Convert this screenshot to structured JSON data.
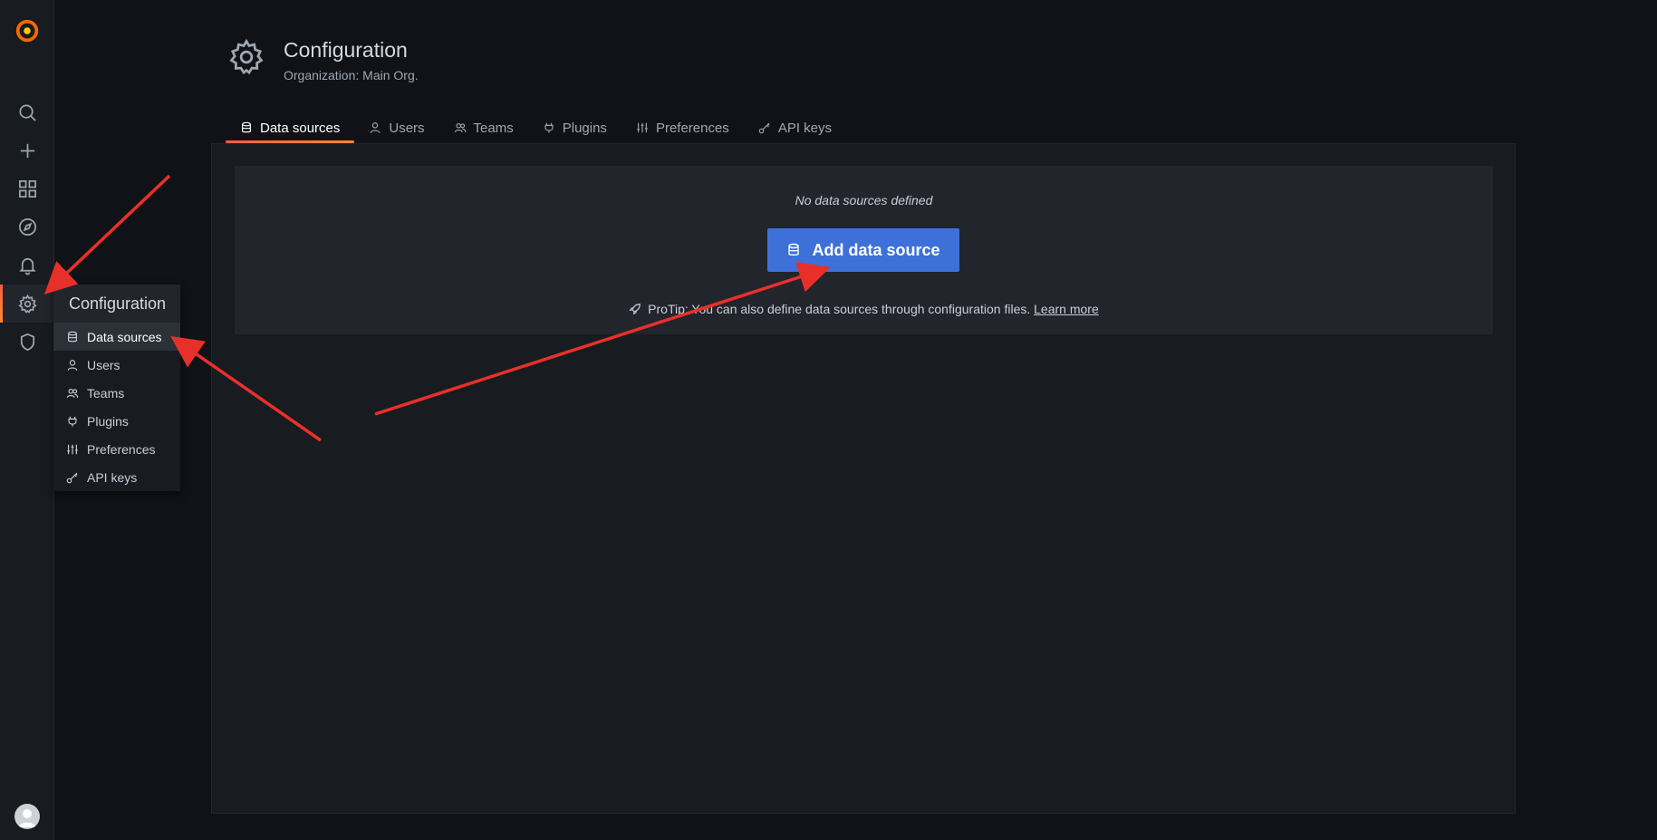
{
  "sidebar": {
    "items": [
      {
        "name": "search-icon"
      },
      {
        "name": "plus-icon"
      },
      {
        "name": "dashboards-icon"
      },
      {
        "name": "explore-icon"
      },
      {
        "name": "bell-icon"
      },
      {
        "name": "gear-icon"
      },
      {
        "name": "shield-icon"
      }
    ]
  },
  "flyout": {
    "title": "Configuration",
    "items": [
      {
        "label": "Data sources",
        "icon": "database-icon"
      },
      {
        "label": "Users",
        "icon": "user-icon"
      },
      {
        "label": "Teams",
        "icon": "users-icon"
      },
      {
        "label": "Plugins",
        "icon": "plug-icon"
      },
      {
        "label": "Preferences",
        "icon": "sliders-icon"
      },
      {
        "label": "API keys",
        "icon": "key-icon"
      }
    ]
  },
  "header": {
    "title": "Configuration",
    "subtitle": "Organization: Main Org."
  },
  "tabs": [
    {
      "label": "Data sources",
      "icon": "database-icon"
    },
    {
      "label": "Users",
      "icon": "user-icon"
    },
    {
      "label": "Teams",
      "icon": "users-icon"
    },
    {
      "label": "Plugins",
      "icon": "plug-icon"
    },
    {
      "label": "Preferences",
      "icon": "sliders-icon"
    },
    {
      "label": "API keys",
      "icon": "key-icon"
    }
  ],
  "main": {
    "empty_message": "No data sources defined",
    "add_button_label": "Add data source",
    "protip_text": "ProTip: You can also define data sources through configuration files.",
    "learn_more": "Learn more"
  },
  "colors": {
    "accent": "#f55f3e",
    "primary_button": "#3d71d9",
    "annotation": "#e8302a"
  }
}
